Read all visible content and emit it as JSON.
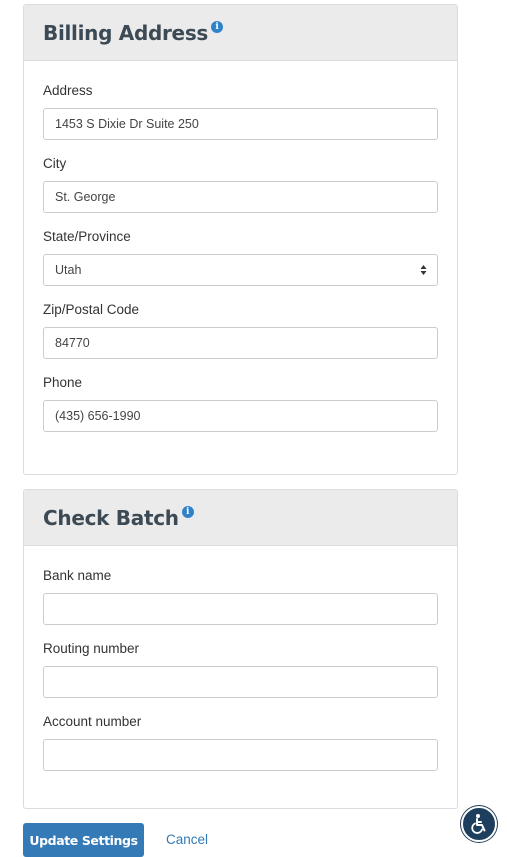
{
  "billing": {
    "title": "Billing Address",
    "info_icon_glyph": "i",
    "address": {
      "label": "Address",
      "value": "1453 S Dixie Dr Suite 250"
    },
    "city": {
      "label": "City",
      "value": "St. George"
    },
    "state": {
      "label": "State/Province",
      "value": "Utah"
    },
    "zip": {
      "label": "Zip/Postal Code",
      "value": "84770"
    },
    "phone": {
      "label": "Phone",
      "value": "(435) 656-1990"
    }
  },
  "check_batch": {
    "title": "Check Batch",
    "info_icon_glyph": "i",
    "bank_name": {
      "label": "Bank name",
      "value": ""
    },
    "routing_number": {
      "label": "Routing number",
      "value": ""
    },
    "account_number": {
      "label": "Account number",
      "value": ""
    }
  },
  "actions": {
    "update_label": "Update Settings",
    "cancel_label": "Cancel"
  },
  "icons": {
    "info": "info-icon",
    "select_arrows": "chevron-up-down-icon",
    "accessibility": "wheelchair-accessibility-icon"
  },
  "colors": {
    "primary": "#337ab7",
    "header_bg": "#ebebeb",
    "title_text": "#3c4a55",
    "info_icon": "#2f82c9",
    "accessibility_bg": "#1d3e5c"
  }
}
